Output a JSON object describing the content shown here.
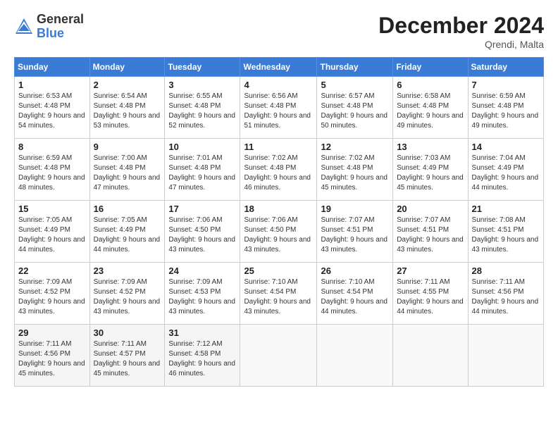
{
  "logo": {
    "general": "General",
    "blue": "Blue"
  },
  "header": {
    "title": "December 2024",
    "location": "Qrendi, Malta"
  },
  "weekdays": [
    "Sunday",
    "Monday",
    "Tuesday",
    "Wednesday",
    "Thursday",
    "Friday",
    "Saturday"
  ],
  "weeks": [
    [
      {
        "day": "1",
        "sunrise": "6:53 AM",
        "sunset": "4:48 PM",
        "daylight": "9 hours and 54 minutes."
      },
      {
        "day": "2",
        "sunrise": "6:54 AM",
        "sunset": "4:48 PM",
        "daylight": "9 hours and 53 minutes."
      },
      {
        "day": "3",
        "sunrise": "6:55 AM",
        "sunset": "4:48 PM",
        "daylight": "9 hours and 52 minutes."
      },
      {
        "day": "4",
        "sunrise": "6:56 AM",
        "sunset": "4:48 PM",
        "daylight": "9 hours and 51 minutes."
      },
      {
        "day": "5",
        "sunrise": "6:57 AM",
        "sunset": "4:48 PM",
        "daylight": "9 hours and 50 minutes."
      },
      {
        "day": "6",
        "sunrise": "6:58 AM",
        "sunset": "4:48 PM",
        "daylight": "9 hours and 49 minutes."
      },
      {
        "day": "7",
        "sunrise": "6:59 AM",
        "sunset": "4:48 PM",
        "daylight": "9 hours and 49 minutes."
      }
    ],
    [
      {
        "day": "8",
        "sunrise": "6:59 AM",
        "sunset": "4:48 PM",
        "daylight": "9 hours and 48 minutes."
      },
      {
        "day": "9",
        "sunrise": "7:00 AM",
        "sunset": "4:48 PM",
        "daylight": "9 hours and 47 minutes."
      },
      {
        "day": "10",
        "sunrise": "7:01 AM",
        "sunset": "4:48 PM",
        "daylight": "9 hours and 47 minutes."
      },
      {
        "day": "11",
        "sunrise": "7:02 AM",
        "sunset": "4:48 PM",
        "daylight": "9 hours and 46 minutes."
      },
      {
        "day": "12",
        "sunrise": "7:02 AM",
        "sunset": "4:48 PM",
        "daylight": "9 hours and 45 minutes."
      },
      {
        "day": "13",
        "sunrise": "7:03 AM",
        "sunset": "4:49 PM",
        "daylight": "9 hours and 45 minutes."
      },
      {
        "day": "14",
        "sunrise": "7:04 AM",
        "sunset": "4:49 PM",
        "daylight": "9 hours and 44 minutes."
      }
    ],
    [
      {
        "day": "15",
        "sunrise": "7:05 AM",
        "sunset": "4:49 PM",
        "daylight": "9 hours and 44 minutes."
      },
      {
        "day": "16",
        "sunrise": "7:05 AM",
        "sunset": "4:49 PM",
        "daylight": "9 hours and 44 minutes."
      },
      {
        "day": "17",
        "sunrise": "7:06 AM",
        "sunset": "4:50 PM",
        "daylight": "9 hours and 43 minutes."
      },
      {
        "day": "18",
        "sunrise": "7:06 AM",
        "sunset": "4:50 PM",
        "daylight": "9 hours and 43 minutes."
      },
      {
        "day": "19",
        "sunrise": "7:07 AM",
        "sunset": "4:51 PM",
        "daylight": "9 hours and 43 minutes."
      },
      {
        "day": "20",
        "sunrise": "7:07 AM",
        "sunset": "4:51 PM",
        "daylight": "9 hours and 43 minutes."
      },
      {
        "day": "21",
        "sunrise": "7:08 AM",
        "sunset": "4:51 PM",
        "daylight": "9 hours and 43 minutes."
      }
    ],
    [
      {
        "day": "22",
        "sunrise": "7:09 AM",
        "sunset": "4:52 PM",
        "daylight": "9 hours and 43 minutes."
      },
      {
        "day": "23",
        "sunrise": "7:09 AM",
        "sunset": "4:52 PM",
        "daylight": "9 hours and 43 minutes."
      },
      {
        "day": "24",
        "sunrise": "7:09 AM",
        "sunset": "4:53 PM",
        "daylight": "9 hours and 43 minutes."
      },
      {
        "day": "25",
        "sunrise": "7:10 AM",
        "sunset": "4:54 PM",
        "daylight": "9 hours and 43 minutes."
      },
      {
        "day": "26",
        "sunrise": "7:10 AM",
        "sunset": "4:54 PM",
        "daylight": "9 hours and 44 minutes."
      },
      {
        "day": "27",
        "sunrise": "7:11 AM",
        "sunset": "4:55 PM",
        "daylight": "9 hours and 44 minutes."
      },
      {
        "day": "28",
        "sunrise": "7:11 AM",
        "sunset": "4:56 PM",
        "daylight": "9 hours and 44 minutes."
      }
    ],
    [
      {
        "day": "29",
        "sunrise": "7:11 AM",
        "sunset": "4:56 PM",
        "daylight": "9 hours and 45 minutes."
      },
      {
        "day": "30",
        "sunrise": "7:11 AM",
        "sunset": "4:57 PM",
        "daylight": "9 hours and 45 minutes."
      },
      {
        "day": "31",
        "sunrise": "7:12 AM",
        "sunset": "4:58 PM",
        "daylight": "9 hours and 46 minutes."
      },
      null,
      null,
      null,
      null
    ]
  ]
}
